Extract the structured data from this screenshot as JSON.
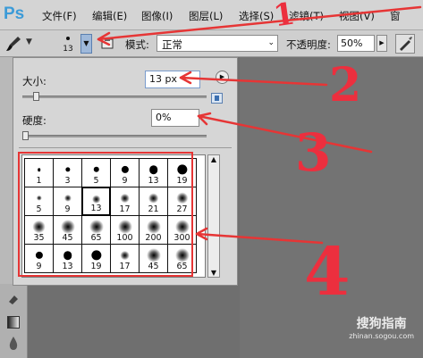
{
  "app": {
    "logo": "Ps"
  },
  "menu": [
    "文件(F)",
    "编辑(E)",
    "图像(I)",
    "图层(L)",
    "选择(S)",
    "滤镜(T)",
    "视图(V)",
    "窗"
  ],
  "options_bar": {
    "brush_size_preview": "13",
    "mode_label": "模式:",
    "mode_value": "正常",
    "opacity_label": "不透明度:",
    "opacity_value": "50%"
  },
  "brush_panel": {
    "size_label": "大小:",
    "size_value": "13 px",
    "size_level": 0.06,
    "hardness_label": "硬度:",
    "hardness_value": "0%",
    "hardness_level": 0.0,
    "presets": [
      {
        "size": "1",
        "kind": "hard"
      },
      {
        "size": "3",
        "kind": "hard"
      },
      {
        "size": "5",
        "kind": "hard"
      },
      {
        "size": "9",
        "kind": "hard"
      },
      {
        "size": "13",
        "kind": "hard"
      },
      {
        "size": "19",
        "kind": "hard"
      },
      {
        "size": "5",
        "kind": "soft"
      },
      {
        "size": "9",
        "kind": "soft"
      },
      {
        "size": "13",
        "kind": "soft",
        "selected": true
      },
      {
        "size": "17",
        "kind": "soft"
      },
      {
        "size": "21",
        "kind": "soft"
      },
      {
        "size": "27",
        "kind": "soft"
      },
      {
        "size": "35",
        "kind": "soft"
      },
      {
        "size": "45",
        "kind": "soft"
      },
      {
        "size": "65",
        "kind": "soft"
      },
      {
        "size": "100",
        "kind": "soft"
      },
      {
        "size": "200",
        "kind": "soft"
      },
      {
        "size": "300",
        "kind": "soft"
      },
      {
        "size": "9",
        "kind": "hard"
      },
      {
        "size": "13",
        "kind": "hard"
      },
      {
        "size": "19",
        "kind": "hard"
      },
      {
        "size": "17",
        "kind": "soft"
      },
      {
        "size": "45",
        "kind": "soft"
      },
      {
        "size": "65",
        "kind": "soft"
      }
    ]
  },
  "annotations": [
    "1",
    "2",
    "3",
    "4"
  ],
  "watermark": {
    "brand": "搜狗指南",
    "url": "zhinan.sogou.com"
  },
  "colors": {
    "annotation": "#e63535",
    "logo": "#3c9bd8"
  }
}
